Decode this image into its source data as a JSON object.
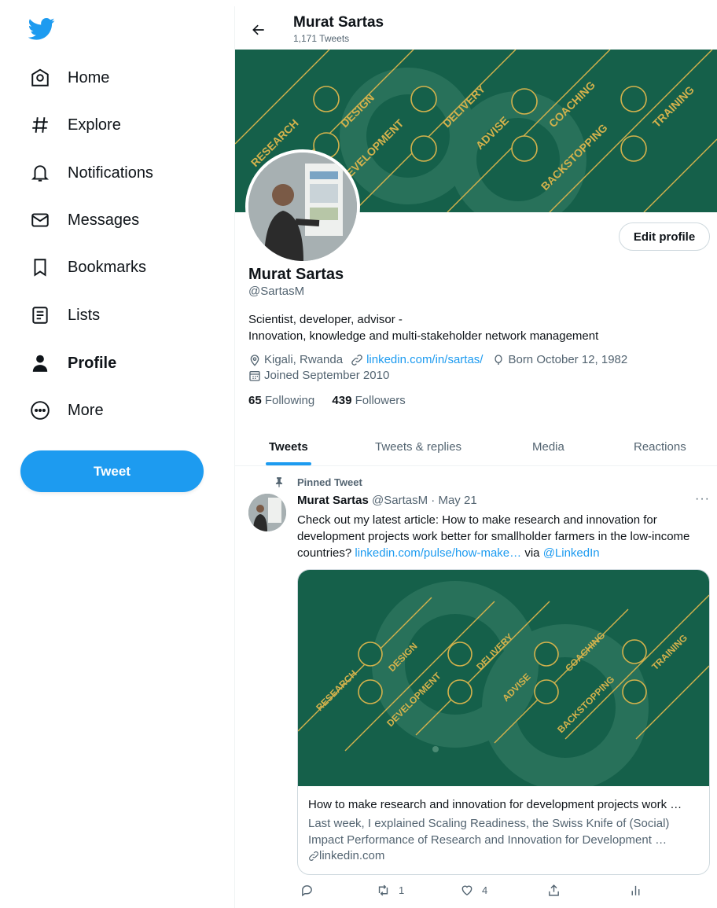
{
  "sidebar": {
    "items": [
      {
        "label": "Home",
        "icon": "home-icon"
      },
      {
        "label": "Explore",
        "icon": "hashtag-icon"
      },
      {
        "label": "Notifications",
        "icon": "bell-icon"
      },
      {
        "label": "Messages",
        "icon": "envelope-icon"
      },
      {
        "label": "Bookmarks",
        "icon": "bookmark-icon"
      },
      {
        "label": "Lists",
        "icon": "list-icon"
      },
      {
        "label": "Profile",
        "icon": "person-icon",
        "active": true
      },
      {
        "label": "More",
        "icon": "more-circle-icon"
      }
    ],
    "tweet_button": "Tweet"
  },
  "header": {
    "name": "Murat Sartas",
    "tweet_count": "1,171 Tweets"
  },
  "banner": {
    "words": [
      "RESEARCH",
      "DESIGN",
      "DEVELOPMENT",
      "DELIVERY",
      "ADVISE",
      "COACHING",
      "BACKSTOPPING",
      "TRAINING"
    ]
  },
  "profile": {
    "edit_button": "Edit profile",
    "name": "Murat Sartas",
    "handle": "@SartasM",
    "bio_line1": "Scientist, developer, advisor -",
    "bio_line2": "Innovation, knowledge and multi-stakeholder network management",
    "location": "Kigali, Rwanda",
    "website": "linkedin.com/in/sartas/",
    "born": "Born October 12, 1982",
    "joined": "Joined September 2010",
    "following_count": "65",
    "following_label": "Following",
    "followers_count": "439",
    "followers_label": "Followers"
  },
  "tabs": [
    {
      "label": "Tweets",
      "active": true
    },
    {
      "label": "Tweets & replies"
    },
    {
      "label": "Media"
    },
    {
      "label": "Reactions"
    }
  ],
  "tweet": {
    "pinned_label": "Pinned Tweet",
    "author_name": "Murat Sartas",
    "author_handle": "@SartasM",
    "separator": "·",
    "date": "May 21",
    "more": "···",
    "text_main": "Check out my latest article: How to make research and innovation for development projects work better for smallholder farmers in the low-income countries?",
    "text_link": "linkedin.com/pulse/how-make…",
    "text_via": "via",
    "text_mention": "@LinkedIn",
    "card": {
      "title": "How to make research and innovation for development projects work …",
      "description": "Last week, I explained Scaling Readiness, the Swiss Knife of (Social) Impact Performance of Research and Innovation for Development …",
      "domain": "linkedin.com"
    },
    "actions": {
      "reply_count": "",
      "retweet_count": "1",
      "like_count": "4"
    }
  },
  "colors": {
    "accent": "#1d9bf0",
    "banner_green": "#15604a",
    "banner_gold": "#d4b24c"
  }
}
